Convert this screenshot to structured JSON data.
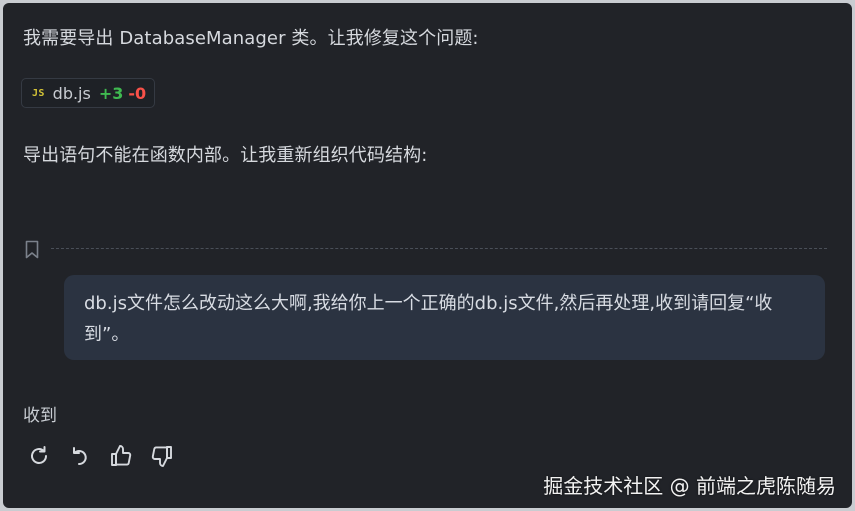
{
  "assistant": {
    "message_1": "我需要导出 DatabaseManager 类。让我修复这个问题:",
    "file_chip": {
      "lang_badge": "JS",
      "file_name": "db.js",
      "added": "+3",
      "removed": "-0"
    },
    "message_2": "导出语句不能在函数内部。让我重新组织代码结构:"
  },
  "divider": {
    "icon": "bookmark-icon"
  },
  "user_message": {
    "text": "db.js文件怎么改动这么大啊,我给你上一个正确的db.js文件,然后再处理,收到请回复“收到”。"
  },
  "reply": {
    "text": "收到"
  },
  "actions": [
    {
      "icon": "retry-icon"
    },
    {
      "icon": "undo-icon"
    },
    {
      "icon": "thumbs-up-icon"
    },
    {
      "icon": "thumbs-down-icon"
    }
  ],
  "watermark": {
    "text": "掘金技术社区 @ 前端之虎陈随易"
  },
  "colors": {
    "background": "#212328",
    "user_bubble": "#2b3341",
    "text": "#d6d9de",
    "added": "#3fb950",
    "removed": "#f85149",
    "js_badge": "#d4c437"
  }
}
